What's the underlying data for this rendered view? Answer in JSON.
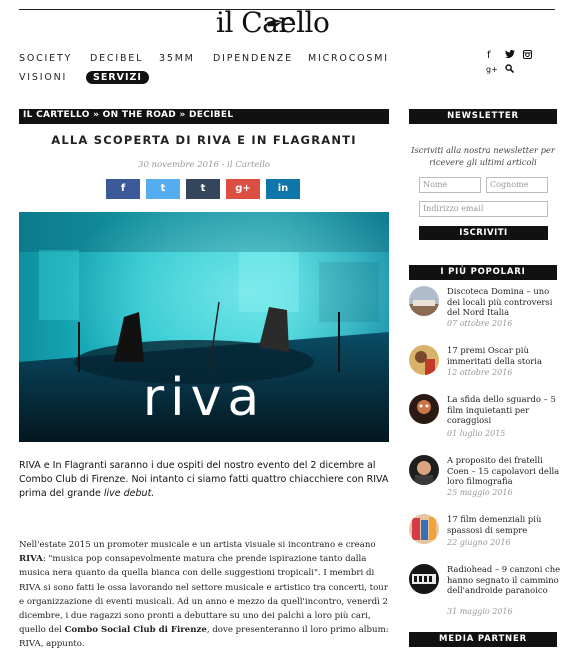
{
  "site": {
    "logo_part1": "il Car",
    "logo_part2": "ello"
  },
  "nav": {
    "items": [
      "SOCIETY",
      "DECIBEL",
      "35MM",
      "DIPENDENZE",
      "MICROCOSMI",
      "VISIONI"
    ],
    "active": "SERVIZI"
  },
  "social_top": [
    "f",
    "t",
    "ig",
    "g+",
    "search"
  ],
  "article": {
    "breadcrumb": "IL CARTELLO » ON THE ROAD » DECIBEL",
    "title": "ALLA SCOPERTA DI RIVA E IN FLAGRANTI",
    "meta": "30 novembre 2016 - il Cartello",
    "share": [
      {
        "label": "f",
        "color": "#3b5998"
      },
      {
        "label": "t",
        "color": "#55acee"
      },
      {
        "label": "t",
        "color": "#35465c"
      },
      {
        "label": "g+",
        "color": "#dc4e41"
      },
      {
        "label": "in",
        "color": "#0e76a8"
      }
    ],
    "hero_logo": "riva",
    "lead": {
      "text": "RIVA e In Flagranti saranno i due ospiti del nostro evento del 2 dicembre al Combo Club di Firenze. Noi intanto ci siamo fatti quattro chiacchiere con RIVA prima del grande ",
      "emph": "live debut."
    },
    "body": {
      "p1": "Nell'estate 2015 un promoter musicale e un artista visuale si incontrano e creano ",
      "b1": "RIVA",
      "p2": ": \"musica pop consapevolmente matura che prende ispirazione tanto dalla musica nera quanto da quella bianca con delle suggestioni tropicali\". I membri di RIVA si sono fatti le ossa lavorando nel settore musicale e artistico tra concerti, tour e organizzazione di eventi musicali. Ad un anno e mezzo da quell'incontro, venerdì 2 dicembre, i due ragazzi sono pronti a debuttare su uno dei palchi a loro più cari, quello del ",
      "b2": "Combo Social Club di Firenze",
      "p3": ", dove presenteranno il loro primo album: RIVA, appunto."
    }
  },
  "sidebar": {
    "newsletter": {
      "heading": "NEWSLETTER",
      "intro": "Iscriviti alla nostra newsletter per ricevere gli ultimi articoli",
      "name_placeholder": "Nome",
      "surname_placeholder": "Cognome",
      "email_placeholder": "Indirizzo email",
      "button": "ISCRIVITI"
    },
    "popular": {
      "heading": "I PIÙ POPOLARI",
      "items": [
        {
          "title": "Discoteca Domina – uno dei locali più controversi del Nord Italia",
          "date": "07 ottobre 2016"
        },
        {
          "title": "17 premi Oscar più immeritati della storia",
          "date": "12 ottobre 2016"
        },
        {
          "title": "La sfida dello sguardo – 5 film inquietanti per coraggiosi",
          "date": "01 luglio 2015"
        },
        {
          "title": "A proposito dei fratelli Coen – 15 capolavori della loro filmografia",
          "date": "25 maggio 2016"
        },
        {
          "title": "17 film demenziali più spassosi di sempre",
          "date": "22 giugno 2016"
        },
        {
          "title": "Radiohead – 9 canzoni che hanno segnato il cammino dell'androide paranoico",
          "date": "31 maggio 2016"
        }
      ]
    },
    "media_partner": {
      "heading": "MEDIA PARTNER"
    }
  }
}
